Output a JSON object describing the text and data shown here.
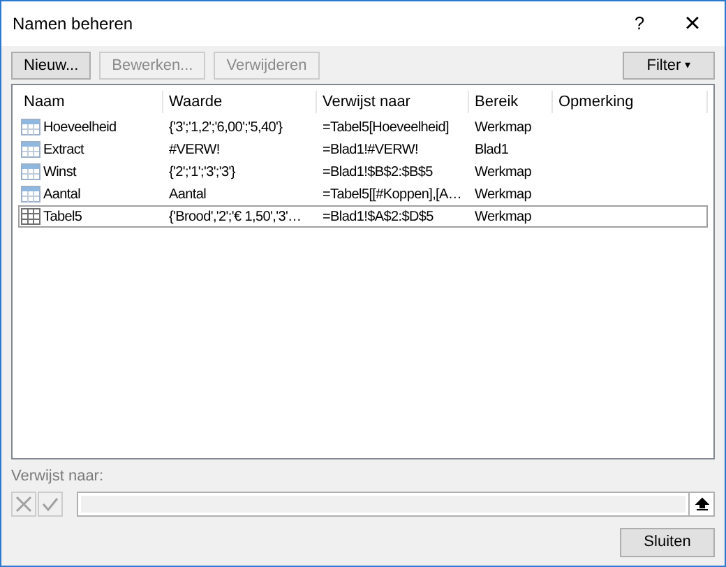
{
  "window": {
    "title": "Namen beheren",
    "help": "?",
    "close": "×"
  },
  "toolbar": [
    {
      "label": "Nieuw...",
      "disabled": false
    },
    {
      "label": "Bewerken...",
      "disabled": true
    },
    {
      "label": "Verwijderen",
      "disabled": true
    }
  ],
  "filter": {
    "label": "Filter",
    "caret": "▾"
  },
  "table": {
    "columns": [
      "Naam",
      "Waarde",
      "Verwijst naar",
      "Bereik",
      "Opmerking"
    ],
    "rows": [
      {
        "kind": "name",
        "selected": false,
        "cells": [
          "Hoeveelheid",
          "{'3';'1,2';'6,00';'5,40'}",
          "=Tabel5[Hoeveelheid]",
          "Werkmap"
        ]
      },
      {
        "kind": "name",
        "selected": false,
        "cells": [
          "Extract",
          "#VERW!",
          "=Blad1!#VERW!",
          "Blad1"
        ]
      },
      {
        "kind": "name",
        "selected": false,
        "cells": [
          "Winst",
          "{'2';'1';'3';'3'}",
          "=Blad1!$B$2:$B$5",
          "Werkmap"
        ]
      },
      {
        "kind": "name",
        "selected": false,
        "cells": [
          "Aantal",
          "Aantal",
          "=Tabel5[[#Koppen],[A…",
          "Werkmap"
        ]
      },
      {
        "kind": "table",
        "selected": true,
        "cells": [
          "Tabel5",
          "{'Brood','2';'€ 1,50','3'…",
          "=Blad1!$A$2:$D$5",
          "Werkmap"
        ]
      }
    ]
  },
  "refers_to": {
    "label": "Verwijst naar:",
    "disabled": true
  },
  "close_button": "Sluiten"
}
